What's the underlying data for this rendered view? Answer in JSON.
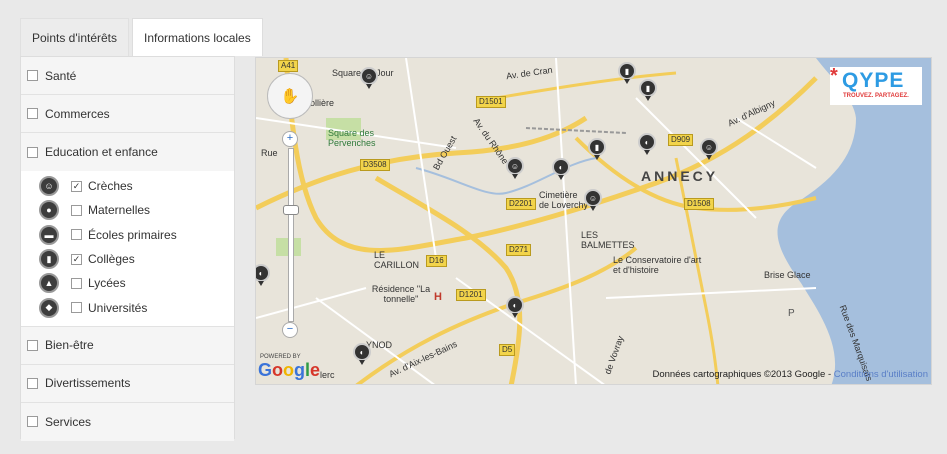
{
  "tabs": [
    {
      "label": "Points d'intérêts",
      "active": false
    },
    {
      "label": "Informations locales",
      "active": true
    }
  ],
  "categories_top": [
    {
      "label": "Santé"
    },
    {
      "label": "Commerces"
    },
    {
      "label": "Education et enfance"
    }
  ],
  "education_items": [
    {
      "label": "Crèches",
      "checked": "✓",
      "icon": "baby-icon"
    },
    {
      "label": "Maternelles",
      "checked": "",
      "icon": "bear-icon"
    },
    {
      "label": "Écoles primaires",
      "checked": "",
      "icon": "schoolbag-icon"
    },
    {
      "label": "Collèges",
      "checked": "✓",
      "icon": "backpack-icon"
    },
    {
      "label": "Lycées",
      "checked": "",
      "icon": "graduation-cap-icon"
    },
    {
      "label": "Universités",
      "checked": "",
      "icon": "mortarboard-icon"
    }
  ],
  "categories_bottom": [
    {
      "label": "Bien-être"
    },
    {
      "label": "Divertissements"
    },
    {
      "label": "Services"
    }
  ],
  "map": {
    "city": "ANNECY",
    "labels": {
      "square_jour": "Square du Jour",
      "square_pervenches": "Square des Pervenches",
      "cemetery": "Cimetière de Loverchy",
      "balmettes": "LES BALMETTES",
      "carillon": "LE CARILLON",
      "residence": "Résidence \"La tonnelle\"",
      "conservatoire": "Le Conservatoire d'art et d'histoire",
      "brise_glace": "Brise Glace",
      "vovray": "de Vovray",
      "cran": "Av. de Cran",
      "albigny": "Av. d'Albigny",
      "bd_ouest": "Bd Ouest",
      "rhone": "Av. du Rhône",
      "aix": "Av. d'Aix-les-Bains",
      "marquisats": "Rue des Marquisats",
      "perolliere": "Perollière",
      "seynod": "YNOD",
      "rue": "Rue",
      "lerc": "lerc"
    },
    "shields": [
      "A41",
      "D1501",
      "D3508",
      "D909",
      "D1508",
      "D2201",
      "D271",
      "D16",
      "D1201",
      "D5"
    ],
    "hospital": "H",
    "parking": "P",
    "pan_icon": "✋",
    "zoom_in": "+",
    "zoom_out": "−",
    "qype_logo": "QYPE",
    "qype_star": "*",
    "qype_tagline": "TROUVEZ. PARTAGEZ.",
    "powered_by": "POWERED BY",
    "google": "Google",
    "attribution": "Données cartographiques ©2013 Google - ",
    "terms": "Conditions d'utilisation"
  },
  "colors": {
    "water": "#a5bfdd",
    "road_major": "#f3cd5a",
    "road_minor": "#ffffff",
    "park": "#c6dfa5",
    "google_blue": "#3a73d9",
    "google_red": "#d6362a",
    "google_yellow": "#f0b400",
    "google_green": "#2f9b45"
  }
}
